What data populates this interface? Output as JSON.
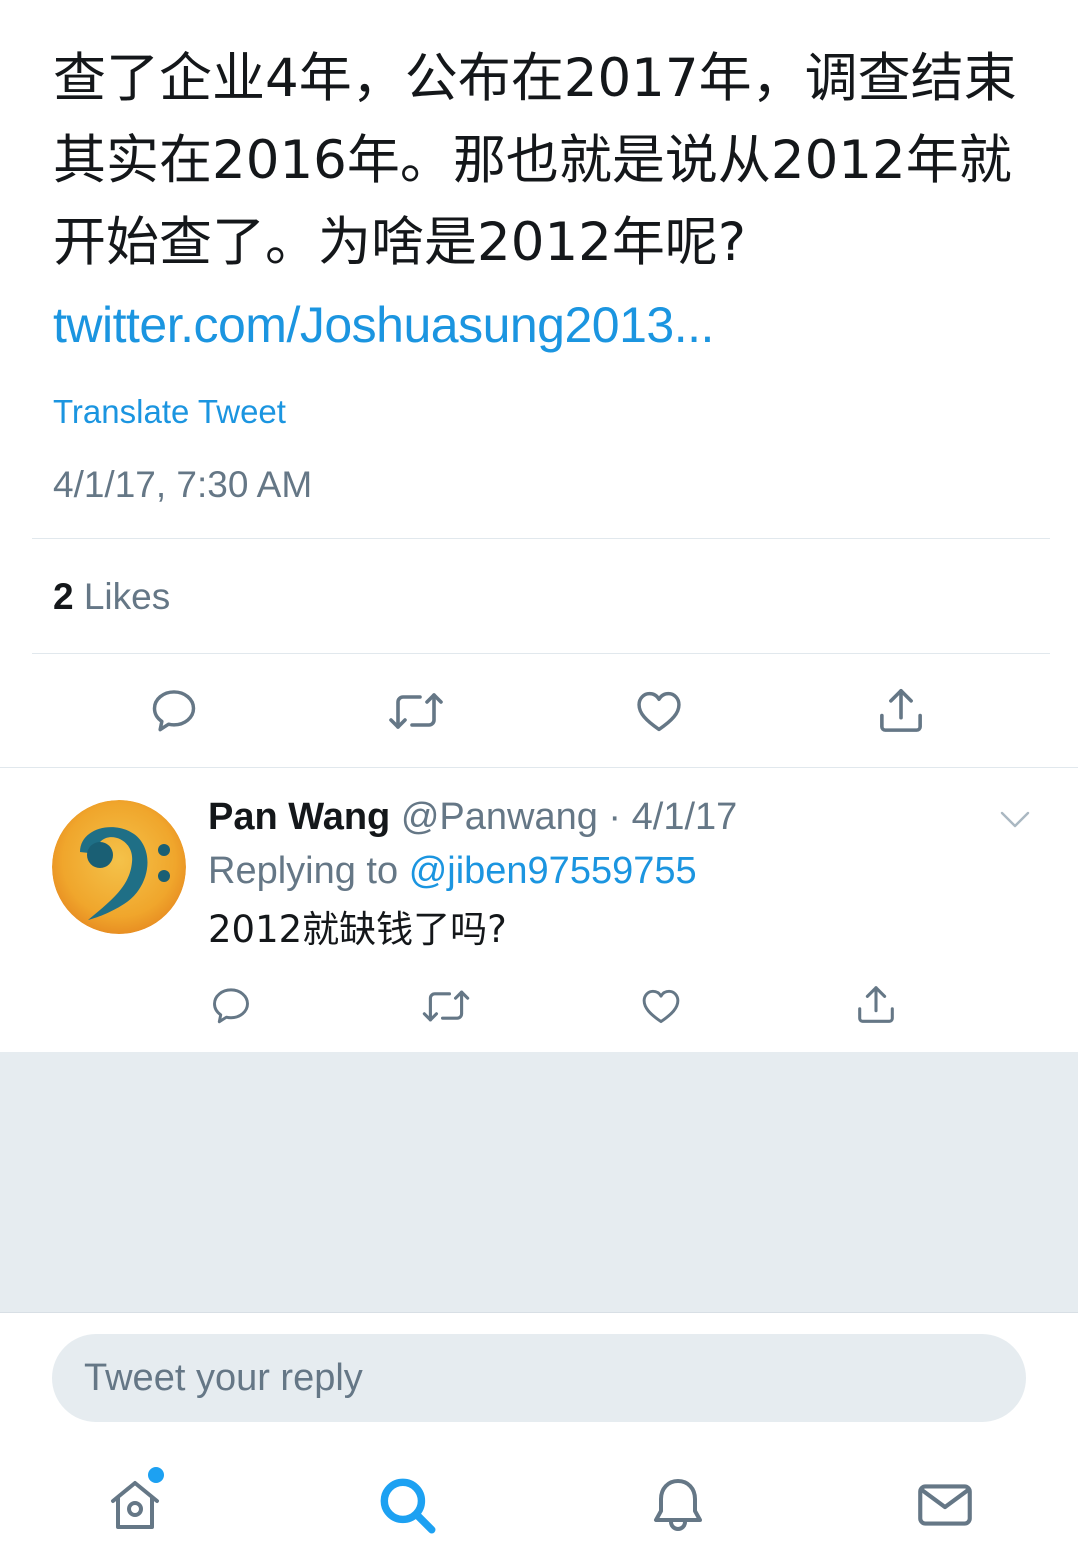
{
  "tweet": {
    "text": "查了企业4年，公布在2017年，调查结束其实在2016年。那也就是说从2012年就开始查了。为啥是2012年呢?",
    "link": "twitter.com/Joshuasung2013...",
    "translate_label": "Translate Tweet",
    "timestamp": "4/1/17, 7:30 AM",
    "likes_count": "2",
    "likes_label": "Likes"
  },
  "reply": {
    "name": "Pan Wang",
    "meta": "@Panwang · 4/1/17",
    "replying_prefix": "Replying to",
    "replying_to": "@jiben97559755",
    "text": "2012就缺钱了吗?"
  },
  "composer": {
    "placeholder": "Tweet your reply"
  },
  "icons": {
    "actions": [
      "reply-icon",
      "retweet-icon",
      "like-icon",
      "share-icon"
    ],
    "tabs": [
      "home-icon",
      "search-icon",
      "notifications-icon",
      "messages-icon"
    ]
  },
  "colors": {
    "accent": "#1da1f2",
    "link": "#1b95e0",
    "icon": "#657786",
    "text": "#14171a",
    "background_grey": "#e6ecf0"
  }
}
